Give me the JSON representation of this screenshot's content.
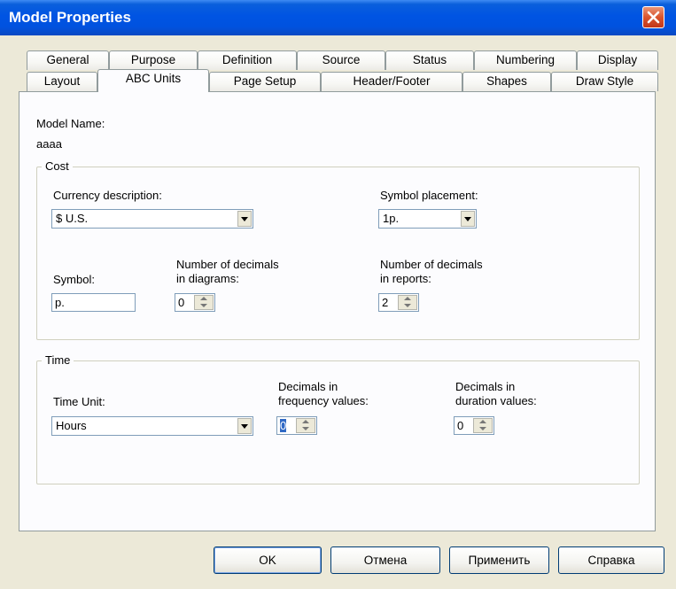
{
  "window": {
    "title": "Model Properties"
  },
  "tabs_row1": [
    "General",
    "Purpose",
    "Definition",
    "Source",
    "Status",
    "Numbering",
    "Display"
  ],
  "tabs_row2": [
    "Layout",
    "ABC Units",
    "Page Setup",
    "Header/Footer",
    "Shapes",
    "Draw Style"
  ],
  "active_tab": "ABC Units",
  "model": {
    "name_label": "Model Name:",
    "name_value": "aaaa"
  },
  "cost": {
    "legend": "Cost",
    "currency_label": "Currency description:",
    "currency_value": "$ U.S.",
    "placement_label": "Symbol placement:",
    "placement_value": "1p.",
    "symbol_label": "Symbol:",
    "symbol_value": "p.",
    "decimals_diagrams_label_1": "Number of decimals",
    "decimals_diagrams_label_2": "in diagrams:",
    "decimals_diagrams_value": "0",
    "decimals_reports_label_1": "Number of decimals",
    "decimals_reports_label_2": "in reports:",
    "decimals_reports_value": "2"
  },
  "time": {
    "legend": "Time",
    "unit_label": "Time Unit:",
    "unit_value": "Hours",
    "freq_label_1": "Decimals in",
    "freq_label_2": "frequency values:",
    "freq_value": "0",
    "duration_label_1": "Decimals in",
    "duration_label_2": "duration values:",
    "duration_value": "0"
  },
  "buttons": {
    "ok": "OK",
    "cancel": "Отмена",
    "apply": "Применить",
    "help": "Справка"
  },
  "colors": {
    "titlebar": "#0054e3",
    "close": "#d9542d",
    "face": "#ece9d8",
    "selection": "#316ac5"
  },
  "icons": {
    "close": "close-icon"
  }
}
